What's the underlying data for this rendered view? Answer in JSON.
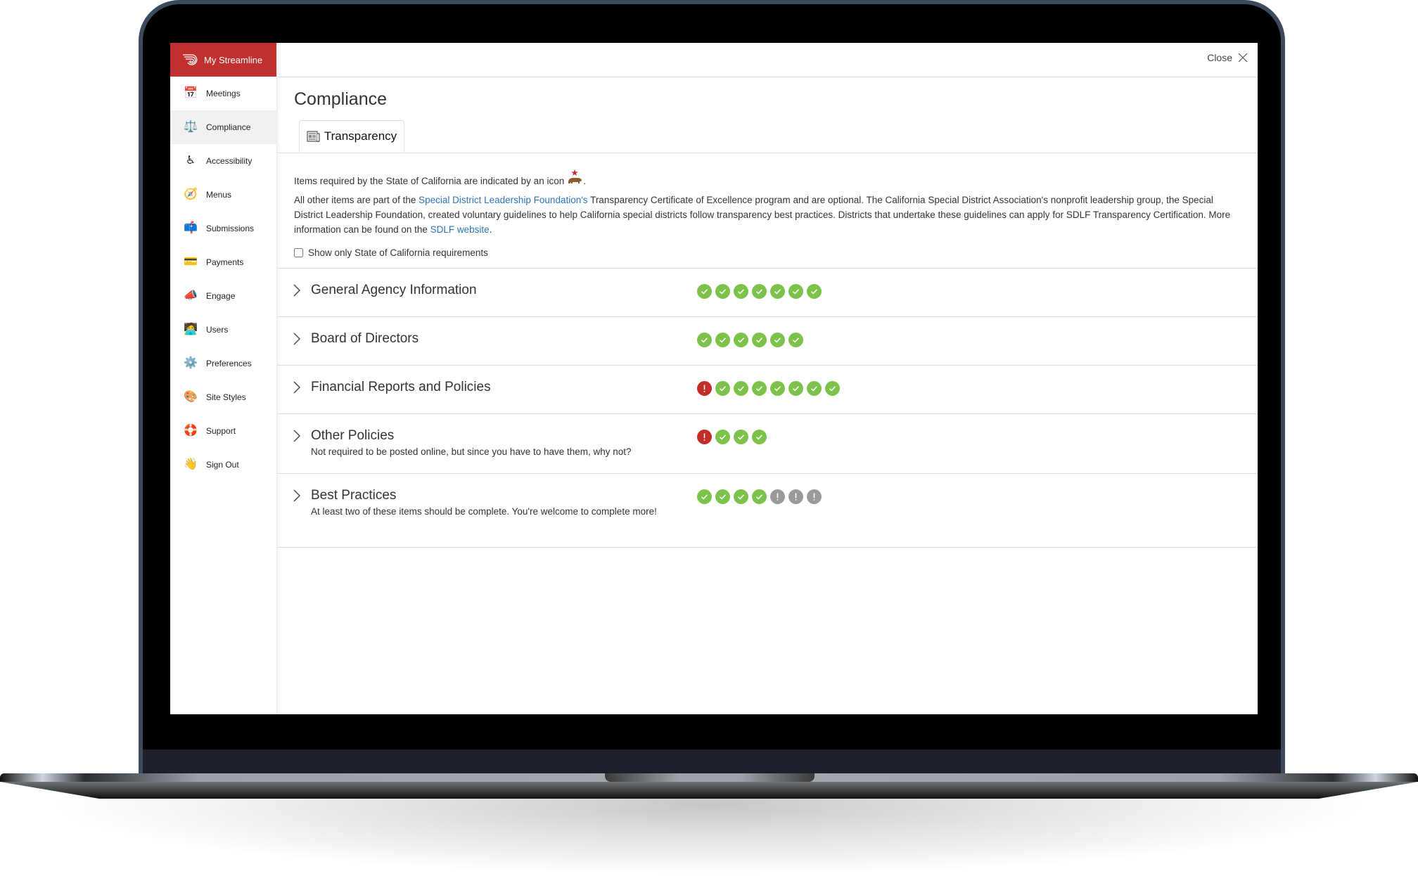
{
  "app": {
    "brand_label": "My Streamline"
  },
  "sidebar": {
    "items": [
      {
        "label": "Meetings",
        "icon": "calendar-icon",
        "glyph": "📅",
        "active": false
      },
      {
        "label": "Compliance",
        "icon": "scales-icon",
        "glyph": "⚖️",
        "active": true
      },
      {
        "label": "Accessibility",
        "icon": "wheelchair-icon",
        "glyph": "♿",
        "active": false
      },
      {
        "label": "Menus",
        "icon": "compass-icon",
        "glyph": "🧭",
        "active": false
      },
      {
        "label": "Submissions",
        "icon": "mailbox-icon",
        "glyph": "📫",
        "active": false
      },
      {
        "label": "Payments",
        "icon": "credit-card-icon",
        "glyph": "💳",
        "active": false
      },
      {
        "label": "Engage",
        "icon": "megaphone-icon",
        "glyph": "📣",
        "active": false
      },
      {
        "label": "Users",
        "icon": "technologist-icon",
        "glyph": "🧑‍💻",
        "active": false
      },
      {
        "label": "Preferences",
        "icon": "gear-icon",
        "glyph": "⚙️",
        "active": false
      },
      {
        "label": "Site Styles",
        "icon": "palette-icon",
        "glyph": "🎨",
        "active": false
      },
      {
        "label": "Support",
        "icon": "lifebuoy-icon",
        "glyph": "🛟",
        "active": false
      },
      {
        "label": "Sign Out",
        "icon": "waving-hand-icon",
        "glyph": "👋",
        "active": false
      }
    ]
  },
  "header": {
    "close_label": "Close"
  },
  "page": {
    "title": "Compliance",
    "tabs": [
      {
        "label": "Transparency",
        "icon": "newspaper-icon",
        "active": true
      }
    ],
    "intro_text": "Items required by the State of California are indicated by an icon",
    "intro_end": ".",
    "description": {
      "part1": "All other items are part of the ",
      "link1": "Special District Leadership Foundation's",
      "part2": " Transparency Certificate of Excellence program and are optional. The California Special District Association's nonprofit leadership group, the Special District Leadership Foundation, created voluntary guidelines to help California special districts follow transparency best practices. Districts that undertake these guidelines can apply for SDLF Transparency Certification. More information can be found on the ",
      "link2": "SDLF website",
      "part3": "."
    },
    "filter": {
      "label": "Show only State of California requirements",
      "checked": false
    }
  },
  "colors": {
    "brand": "#c0302e",
    "complete": "#7dc24b",
    "missing_required": "#c22d2a",
    "incomplete_optional": "#9a9a9a",
    "link": "#2f73b8"
  },
  "sections": [
    {
      "title": "General Agency Information",
      "subtitle": "",
      "statuses": [
        "complete",
        "complete",
        "complete",
        "complete",
        "complete",
        "complete",
        "complete"
      ]
    },
    {
      "title": "Board of Directors",
      "subtitle": "",
      "statuses": [
        "complete",
        "complete",
        "complete",
        "complete",
        "complete",
        "complete"
      ]
    },
    {
      "title": "Financial Reports and Policies",
      "subtitle": "",
      "statuses": [
        "missing",
        "complete",
        "complete",
        "complete",
        "complete",
        "complete",
        "complete",
        "complete"
      ]
    },
    {
      "title": "Other Policies",
      "subtitle": "Not required to be posted online, but since you have to have them, why not?",
      "statuses": [
        "missing",
        "complete",
        "complete",
        "complete"
      ]
    },
    {
      "title": "Best Practices",
      "subtitle": "At least two of these items should be complete. You're welcome to complete more!",
      "statuses": [
        "complete",
        "complete",
        "complete",
        "complete",
        "incomplete",
        "incomplete",
        "incomplete"
      ]
    }
  ]
}
